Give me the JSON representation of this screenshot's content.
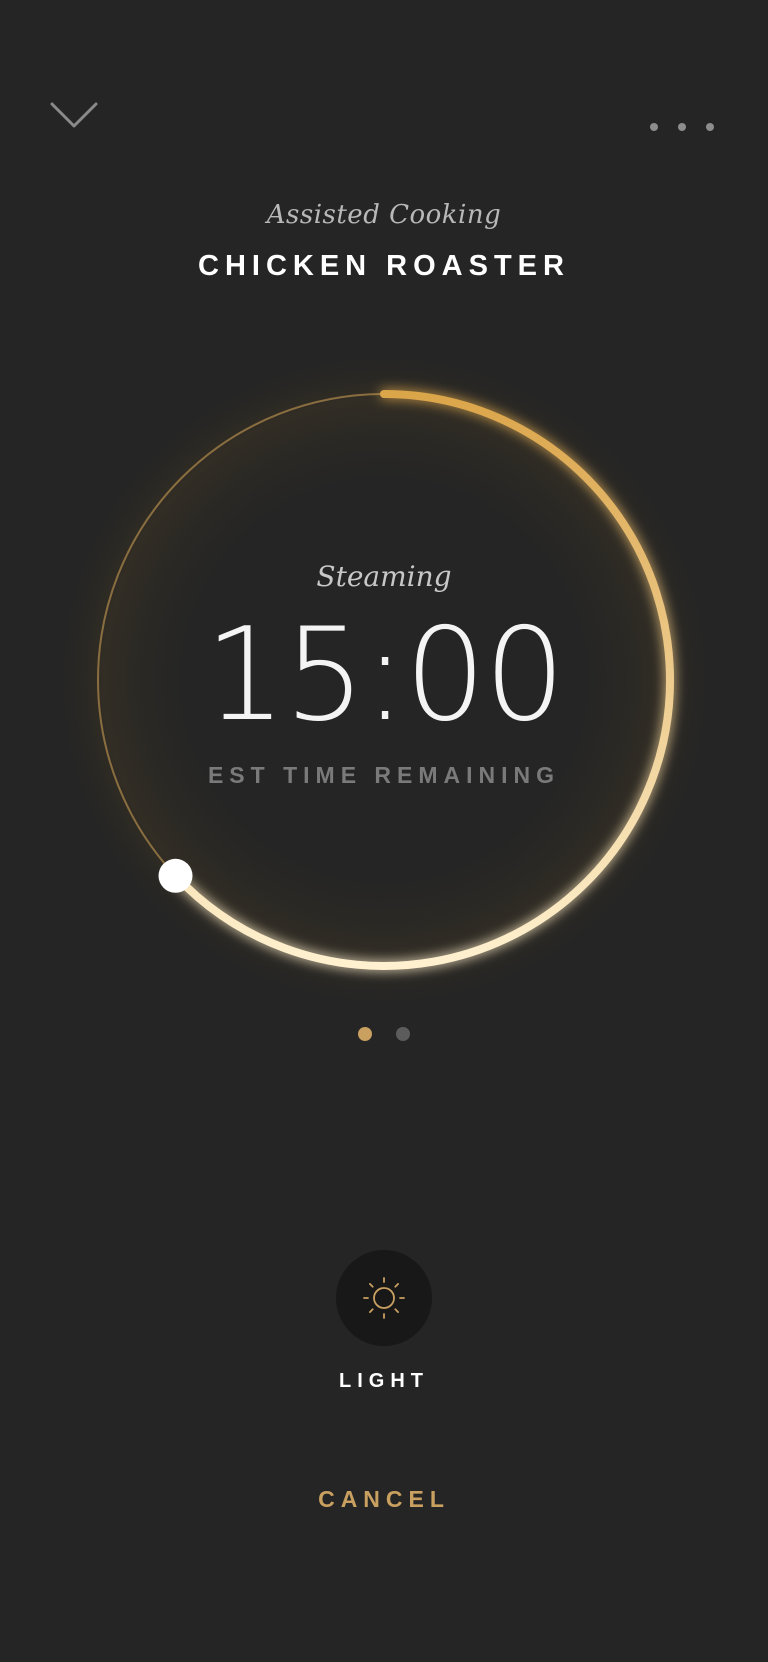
{
  "header": {
    "subtitle": "Assisted Cooking",
    "title": "CHICKEN ROASTER",
    "back_icon": "chevron-down-icon",
    "menu_icon": "more-horizontal-icon"
  },
  "timer": {
    "phase": "Steaming",
    "time": "15:00",
    "label": "EST TIME REMAINING",
    "progress": 0.63
  },
  "pager": {
    "count": 2,
    "active_index": 0
  },
  "light_control": {
    "icon": "sun-icon",
    "label": "LIGHT"
  },
  "actions": {
    "cancel_label": "CANCEL"
  },
  "colors": {
    "background": "#252525",
    "accent": "#c9a060",
    "ring_start": "#dba54a",
    "ring_end": "#fff1d0",
    "pager_inactive": "#5c5c5c",
    "cancel": "#c9a060"
  }
}
